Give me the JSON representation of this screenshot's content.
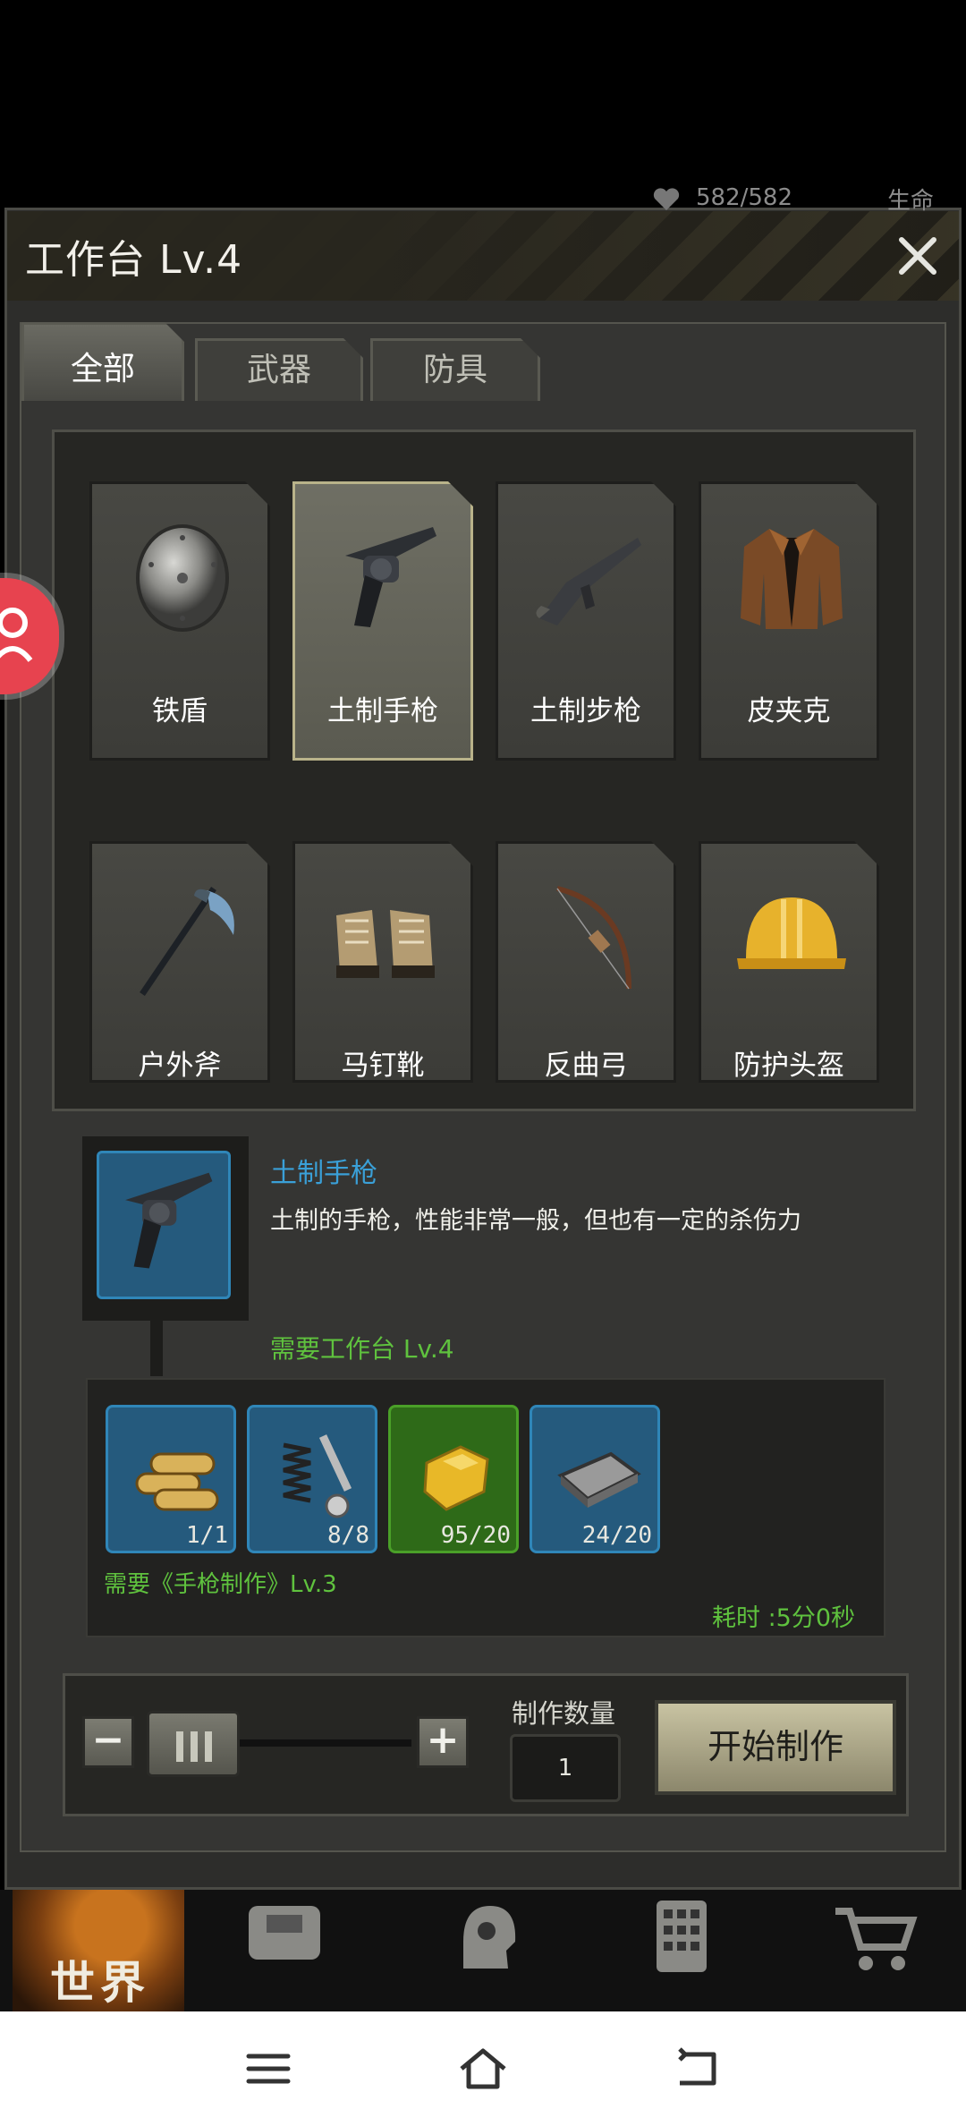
{
  "status": {
    "hp": "582/582",
    "hp_label": "生命"
  },
  "panel": {
    "title": "工作台 Lv.4"
  },
  "tabs": [
    {
      "label": "全部",
      "active": true
    },
    {
      "label": "武器",
      "active": false
    },
    {
      "label": "防具",
      "active": false
    }
  ],
  "items": [
    {
      "name": "铁盾",
      "icon": "iron-shield-icon",
      "selected": false
    },
    {
      "name": "土制手枪",
      "icon": "pistol-icon",
      "selected": true
    },
    {
      "name": "土制步枪",
      "icon": "rifle-icon",
      "selected": false
    },
    {
      "name": "皮夹克",
      "icon": "leather-jacket-icon",
      "selected": false
    },
    {
      "name": "户外斧",
      "icon": "axe-icon",
      "selected": false
    },
    {
      "name": "马钉靴",
      "icon": "boots-icon",
      "selected": false
    },
    {
      "name": "反曲弓",
      "icon": "bow-icon",
      "selected": false
    },
    {
      "name": "防护头盔",
      "icon": "helmet-icon",
      "selected": false
    }
  ],
  "detail": {
    "name": "土制手枪",
    "description": "土制的手枪，性能非常一般，但也有一定的杀伤力",
    "requirement": "需要工作台 Lv.4",
    "skill_requirement": "需要《手枪制作》Lv.3",
    "time": "耗时 :5分0秒"
  },
  "materials": [
    {
      "icon": "pipes-icon",
      "count": "1/1",
      "color": "#255a7d"
    },
    {
      "icon": "springs-bolts-icon",
      "count": "8/8",
      "color": "#255a7d"
    },
    {
      "icon": "gold-nugget-icon",
      "count": "95/20",
      "color": "#2e6a18"
    },
    {
      "icon": "metal-plate-icon",
      "count": "24/20",
      "color": "#255a7d"
    }
  ],
  "craft": {
    "quantity_label": "制作数量",
    "quantity": "1",
    "minus": "−",
    "plus": "+",
    "start_label": "开始制作"
  },
  "game_nav": {
    "world_label": "世界",
    "icons": [
      "backpack-icon",
      "head-gear-icon",
      "calculator-icon",
      "cart-icon"
    ]
  },
  "system_nav": [
    "menu-icon",
    "home-icon",
    "back-icon"
  ]
}
